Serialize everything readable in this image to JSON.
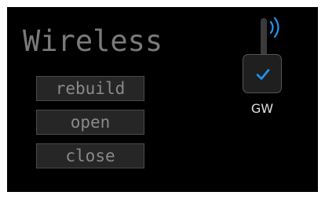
{
  "panel": {
    "title": "Wireless"
  },
  "actions": {
    "rebuild_label": "rebuild",
    "open_label": "open",
    "close_label": "close"
  },
  "gateway": {
    "label": "GW",
    "status_icon": "check-icon",
    "signal_icon": "wifi-signal-icon",
    "accent_color": "#2196f3"
  },
  "colors": {
    "background": "#000000",
    "button_bg": "#262626",
    "text_muted": "#8a8a8a",
    "gateway_label": "#e0e0e0"
  }
}
